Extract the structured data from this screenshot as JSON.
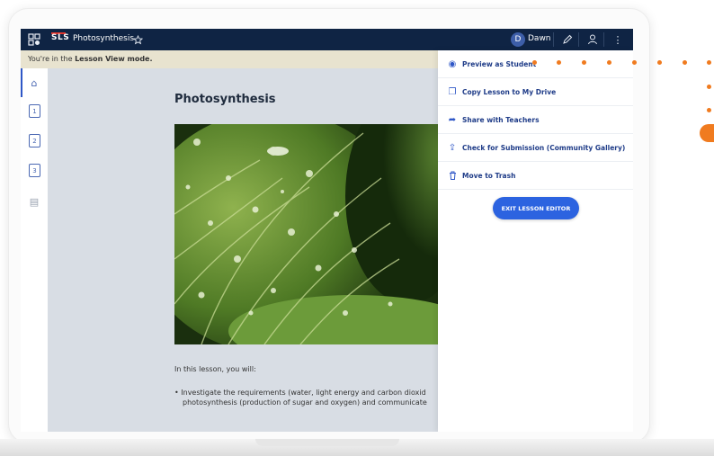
{
  "topbar": {
    "logo": "SLS",
    "title": "Photosynthesis",
    "user_initial": "D",
    "user_name": "Dawn",
    "more_glyph": "⋮"
  },
  "mode_banner": {
    "prefix": "You're in the ",
    "mode": "Lesson View mode."
  },
  "sidebar": {
    "items": [
      {
        "name": "home-icon",
        "glyph": "⌂"
      },
      {
        "name": "page-1-icon",
        "glyph": "1"
      },
      {
        "name": "page-2-icon",
        "glyph": "2"
      },
      {
        "name": "page-3-icon",
        "glyph": "3"
      },
      {
        "name": "pages-icon",
        "glyph": "▤"
      }
    ]
  },
  "lesson": {
    "title": "Photosynthesis",
    "intro": "In this lesson, you will:",
    "bullets": [
      "Investigate the requirements (water, light energy and carbon dioxid",
      "photosynthesis (production of sugar and oxygen) and communicate"
    ]
  },
  "menu": {
    "items": [
      {
        "label": "Preview as Student",
        "icon": "eye-icon",
        "glyph": "◉"
      },
      {
        "label": "Copy Lesson to My Drive",
        "icon": "copy-icon",
        "glyph": "❐"
      },
      {
        "label": "Share with Teachers",
        "icon": "share-icon",
        "glyph": "➦"
      },
      {
        "label": "Check for Submission (Community Gallery)",
        "icon": "upload-icon",
        "glyph": "⇪"
      },
      {
        "label": "Move to Trash",
        "icon": "trash-icon",
        "glyph": "🗑"
      }
    ],
    "exit_button": "EXIT LESSON EDITOR"
  },
  "colors": {
    "topbar": "#0f2444",
    "accent": "#2c63e0",
    "annotation_dots": "#f07b1f",
    "banner": "#e8e3cf"
  }
}
